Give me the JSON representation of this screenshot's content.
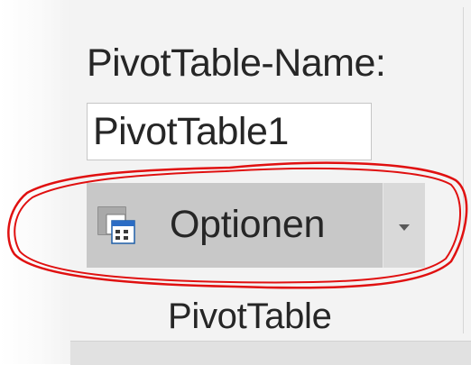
{
  "pivottable_group": {
    "name_label": "PivotTable-Name:",
    "name_value": "PivotTable1",
    "options_button": {
      "label": "Optionen",
      "icon": "pivot-options-icon",
      "dropdown_icon": "chevron-down-icon"
    },
    "group_label": "PivotTable"
  },
  "annotation": {
    "shape": "hand-drawn-ellipse",
    "color": "#e01010",
    "target": "options_button"
  },
  "colors": {
    "ribbon_background": "#f3f3f3",
    "button_hover": "#c8c8c8",
    "text": "#262626"
  }
}
